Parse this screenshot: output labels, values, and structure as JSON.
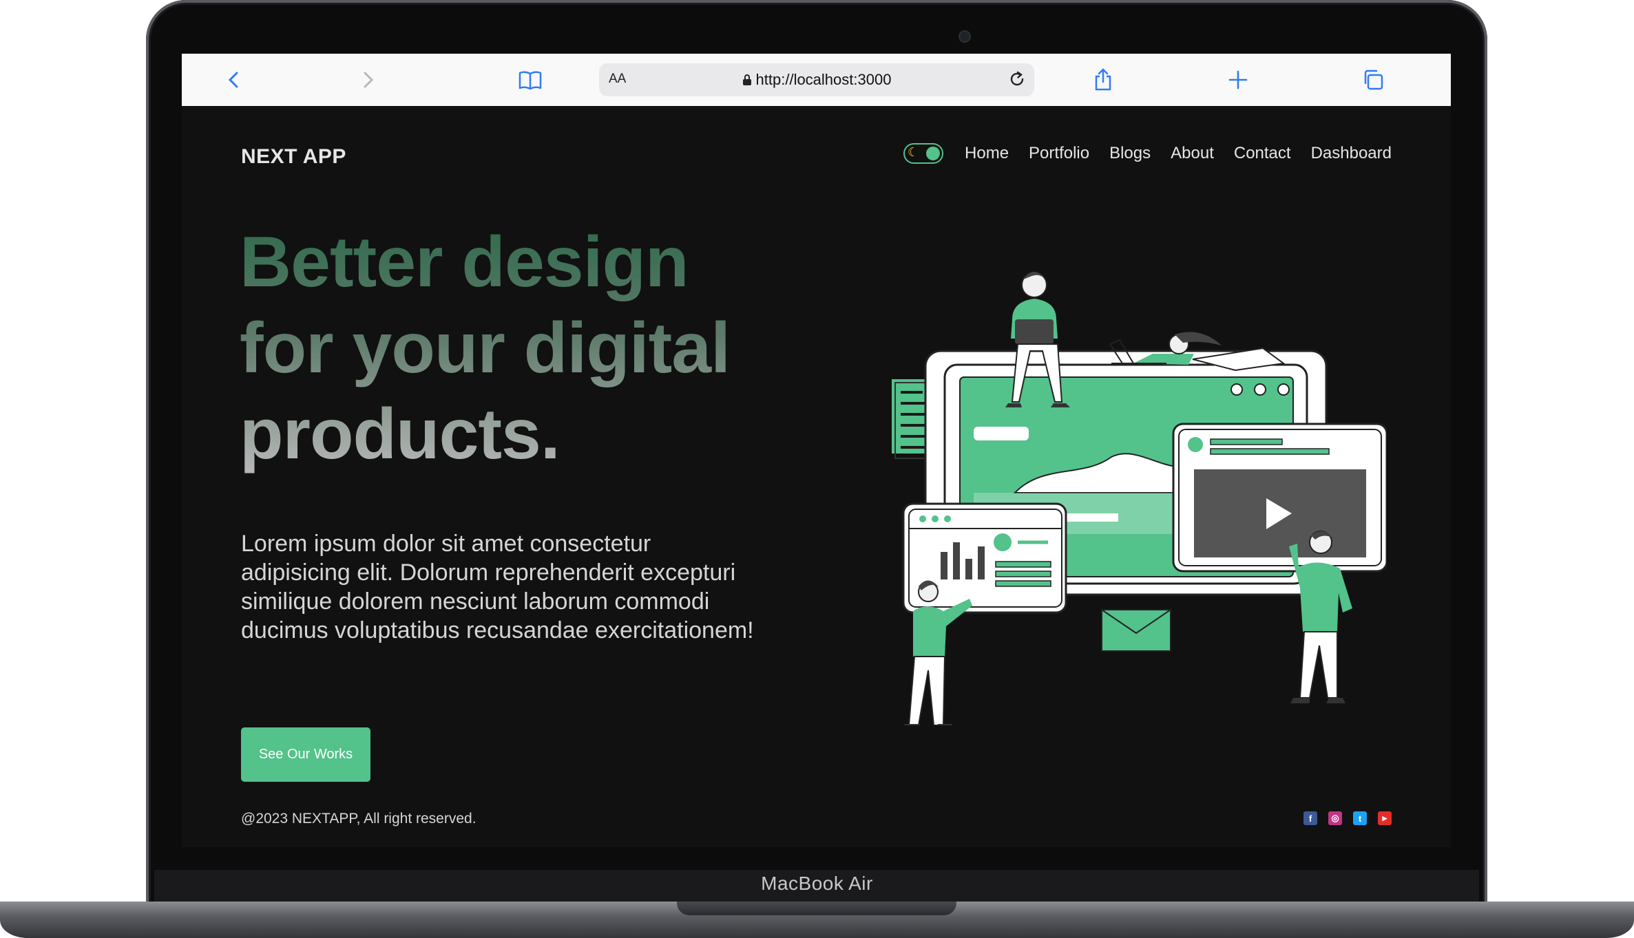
{
  "device": {
    "label": "MacBook Air"
  },
  "browser": {
    "text_size_label": "AA",
    "url": "http://localhost:3000"
  },
  "site": {
    "logo": "NEXT APP",
    "nav": [
      "Home",
      "Portfolio",
      "Blogs",
      "About",
      "Contact",
      "Dashboard"
    ],
    "theme_toggle": {
      "icon": "moon-icon",
      "state": "dark"
    },
    "hero": {
      "title_line1": "Better design",
      "title_line2": "for your digital",
      "title_line3": "products.",
      "description": "Lorem ipsum dolor sit amet consectetur adipisicing elit. Dolorum reprehenderit excepturi similique dolorem nesciunt laborum commodi ducimus voluptatibus recusandae exercitationem!",
      "cta_label": "See Our Works"
    },
    "footer": {
      "copyright": "@2023 NEXTAPP, All right reserved.",
      "socials": [
        {
          "icon": "facebook-icon",
          "glyph": "f",
          "color": "#3b5998"
        },
        {
          "icon": "instagram-icon",
          "glyph": "◎",
          "color": "#c13584"
        },
        {
          "icon": "twitter-icon",
          "glyph": "t",
          "color": "#1da1f2"
        },
        {
          "icon": "youtube-icon",
          "glyph": "▶",
          "color": "#e52d27"
        }
      ]
    }
  },
  "colors": {
    "accent": "#53c28b",
    "background": "#111111",
    "text": "#d6d6d6"
  }
}
